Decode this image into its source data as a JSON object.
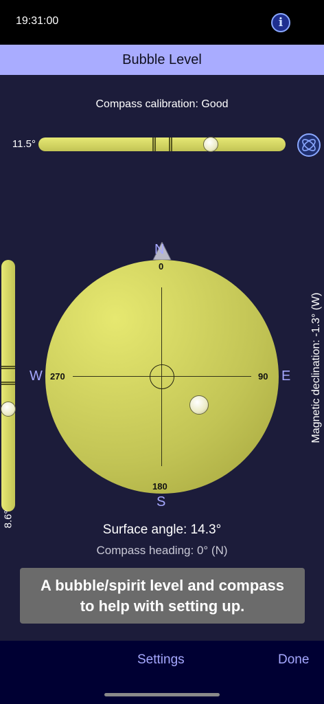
{
  "status_bar": {
    "time": "19:31:00"
  },
  "nav": {
    "title": "Bubble Level"
  },
  "calibration": "Compass calibration: Good",
  "horizontal_level": {
    "angle_label": "11.5°",
    "bubble_position": 0.71
  },
  "vertical_level": {
    "angle_label": "8.6°",
    "bubble_position": 0.6
  },
  "magnetic_declination": "Magnetic declination: -1.3° (W)",
  "compass": {
    "cardinals": {
      "north": "N",
      "south": "S",
      "east": "E",
      "west": "W"
    },
    "degrees": {
      "top": "0",
      "right": "90",
      "bottom": "180",
      "left": "270"
    }
  },
  "readouts": {
    "surface_angle": "Surface angle: 14.3°",
    "compass_heading": "Compass heading: 0° (N)"
  },
  "tip": "A bubble/spirit level and compass\nto help with setting up.",
  "bottom_bar": {
    "settings": "Settings",
    "done": "Done"
  },
  "colors": {
    "nav_bar": "#a9acff",
    "background": "#1c1c3a",
    "level_fill": "#d9db66",
    "accent_text": "#a6a8ff",
    "bottom_bar": "#000033"
  }
}
